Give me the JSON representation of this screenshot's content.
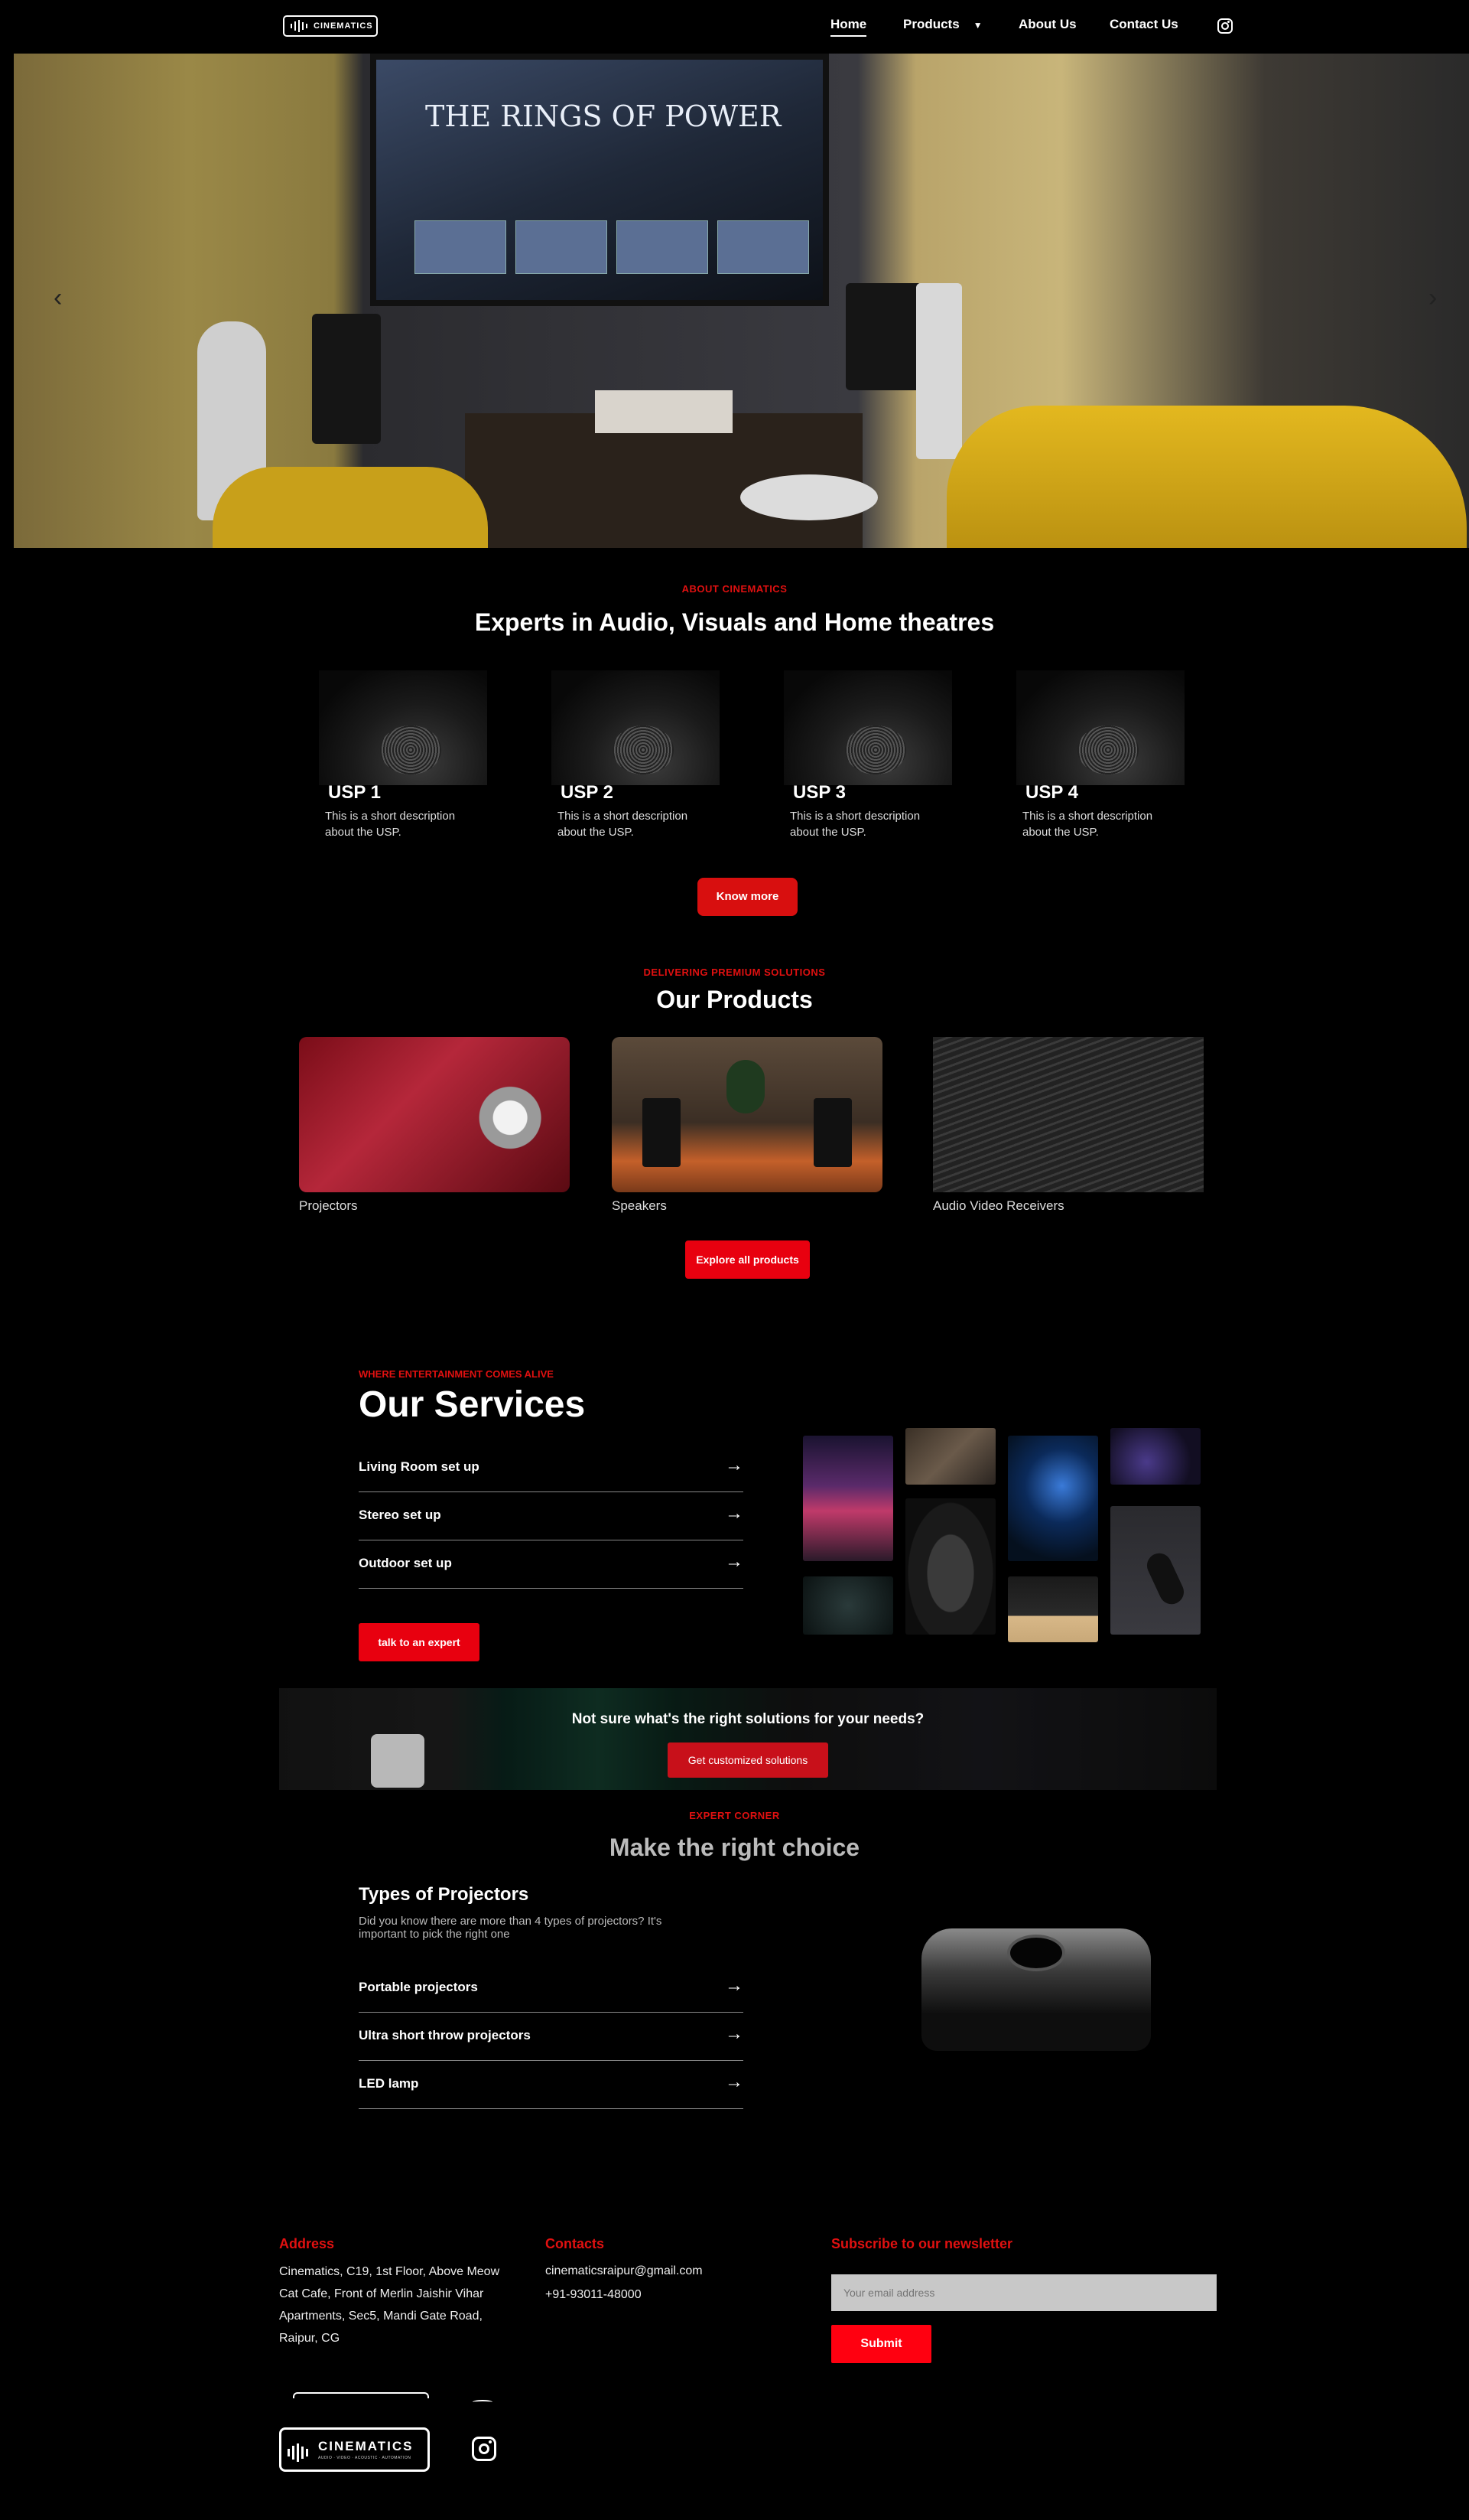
{
  "nav": {
    "logo_text": "CINEMATICS",
    "links": [
      "Home",
      "Products",
      "About Us",
      "Contact Us"
    ]
  },
  "hero": {
    "tv_title": "THE RINGS OF POWER",
    "prev": "‹",
    "next": "›"
  },
  "about": {
    "eyebrow": "ABOUT CINEMATICS",
    "title": "Experts in Audio, Visuals and Home theatres",
    "usps": [
      {
        "title": "USP 1",
        "desc": "This is a short description about the USP."
      },
      {
        "title": "USP 2",
        "desc": "This is a short description about the USP."
      },
      {
        "title": "USP 3",
        "desc": "This is a short description about the USP."
      },
      {
        "title": "USP 4",
        "desc": "This is a short description about the USP."
      }
    ],
    "button": "Know more"
  },
  "products": {
    "eyebrow": "DELIVERING PREMIUM SOLUTIONS",
    "title": "Our Products",
    "items": [
      "Projectors",
      "Speakers",
      "Audio Video Receivers"
    ],
    "button": "Explore all products"
  },
  "services": {
    "eyebrow": "WHERE ENTERTAINMENT COMES ALIVE",
    "title": "Our Services",
    "items": [
      "Living Room set up",
      "Stereo set up",
      "Outdoor set up"
    ],
    "arrow": "→",
    "button": "talk to an expert"
  },
  "cta": {
    "text": "Not sure what's the right solutions for your needs?",
    "button": "Get customized solutions"
  },
  "expert": {
    "eyebrow": "EXPERT CORNER",
    "title": "Make the right choice",
    "subtitle": "Types of Projectors",
    "desc": "Did you know there are more than 4 types of projectors? It's important to pick the right one",
    "items": [
      "Portable projectors",
      "Ultra short throw projectors",
      "LED lamp"
    ]
  },
  "footer": {
    "address_heading": "Address",
    "address": "Cinematics, C19, 1st Floor, Above Meow Cat Cafe, Front of Merlin Jaishir Vihar Apartments, Sec5, Mandi Gate Road, Raipur, CG",
    "contacts_heading": "Contacts",
    "email": "cinematicsraipur@gmail.com",
    "phone": "+91-93011-48000",
    "newsletter_heading": "Subscribe to our newsletter",
    "email_placeholder": "Your email address",
    "submit": "Submit",
    "logo_text": "CINEMATICS",
    "logo_tagline": "AUDIO · VIDEO · ACOUSTIC · AUTOMATION"
  },
  "colors": {
    "accent": "#d80f0f",
    "background": "#000000"
  }
}
